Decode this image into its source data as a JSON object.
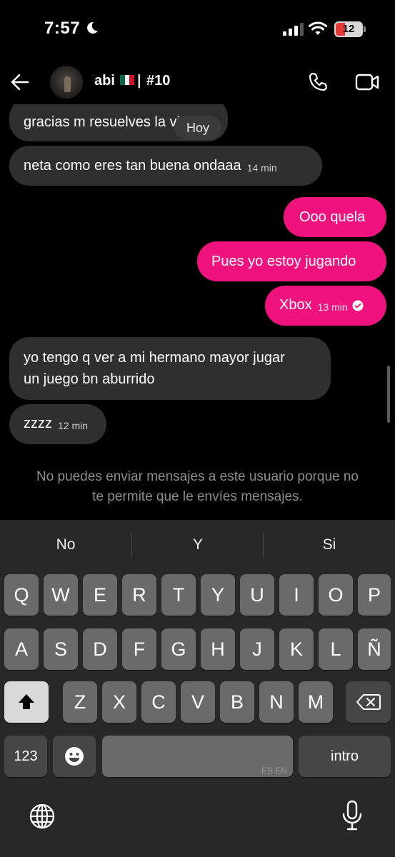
{
  "status_bar": {
    "time": "7:57",
    "battery": "12"
  },
  "header": {
    "name": "abi",
    "separator": "|",
    "tag": "#10"
  },
  "day_label": "Hoy",
  "messages": [
    {
      "side": "received",
      "text": "gracias m resuelves la vida"
    },
    {
      "side": "received",
      "text": "neta como eres tan buena ondaaa",
      "time": "14 min"
    },
    {
      "side": "sent",
      "text": "Ooo quela"
    },
    {
      "side": "sent",
      "text": "Pues yo estoy jugando"
    },
    {
      "side": "sent",
      "text": "Xbox",
      "time": "13 min",
      "status": "read"
    },
    {
      "side": "received",
      "line1": "yo tengo q ver a mi hermano mayor jugar",
      "line2": "un juego bn aburrido"
    },
    {
      "side": "received",
      "text": "zzzz",
      "time": "12 min"
    }
  ],
  "notice": {
    "line1": "No puedes enviar mensajes a este usuario porque no",
    "line2": "te permite que le envíes mensajes."
  },
  "keyboard": {
    "suggestions": [
      "No",
      "Y",
      "Si"
    ],
    "row1": [
      "Q",
      "W",
      "E",
      "R",
      "T",
      "Y",
      "U",
      "I",
      "O",
      "P"
    ],
    "row2": [
      "A",
      "S",
      "D",
      "F",
      "G",
      "H",
      "J",
      "K",
      "L",
      "Ñ"
    ],
    "row3": [
      "Z",
      "X",
      "C",
      "V",
      "B",
      "N",
      "M"
    ],
    "numbers_label": "123",
    "space_language": "ES EN",
    "return_label": "intro"
  },
  "colors": {
    "sent_bubble": "#f0137e",
    "received_bubble": "#2f2f2f",
    "background": "#000000"
  },
  "icons": [
    "back-arrow-icon",
    "phone-icon",
    "video-camera-icon",
    "check-circle-icon",
    "shift-icon",
    "backspace-icon",
    "emoji-icon",
    "globe-icon",
    "microphone-icon"
  ]
}
